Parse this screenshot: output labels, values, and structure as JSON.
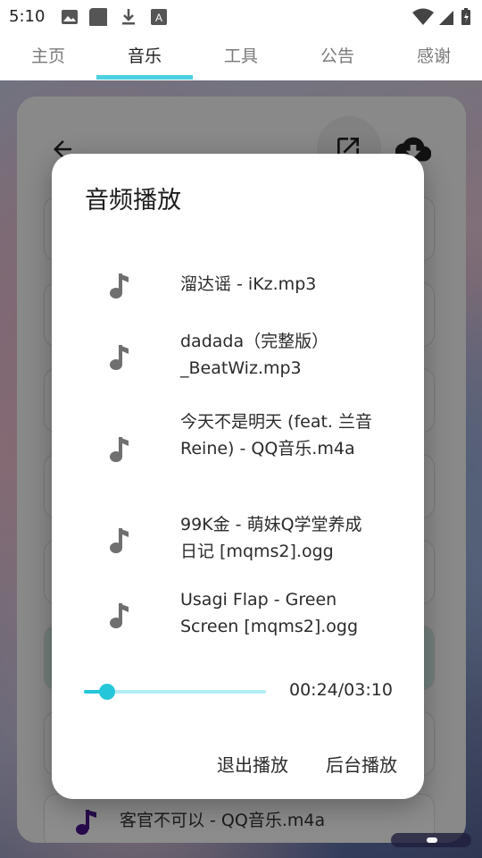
{
  "status": {
    "time": "5:10"
  },
  "tabs": [
    {
      "label": "主页"
    },
    {
      "label": "音乐"
    },
    {
      "label": "工具"
    },
    {
      "label": "公告"
    },
    {
      "label": "感谢"
    }
  ],
  "background_page": {
    "bottom_item_label": "客官不可以 - QQ音乐.m4a"
  },
  "dialog": {
    "title": "音频播放",
    "tracks": [
      {
        "name": "溜达谣 - iKz.mp3"
      },
      {
        "name": "dadada（完整版）_BeatWiz.mp3"
      },
      {
        "name": "今天不是明天 (feat. 兰音Reine) - QQ音乐.m4a"
      },
      {
        "name": "99K金 - 萌妹Q学堂养成日记 [mqms2].ogg"
      },
      {
        "name": "Usagi Flap - Green Screen [mqms2].ogg"
      }
    ],
    "progress": {
      "time": "00:24/03:10",
      "fraction": 0.126
    },
    "exit_button": "退出播放",
    "background_button": "后台播放"
  },
  "colors": {
    "accent": "#26c6da",
    "indicator": "#4dd0e1"
  }
}
